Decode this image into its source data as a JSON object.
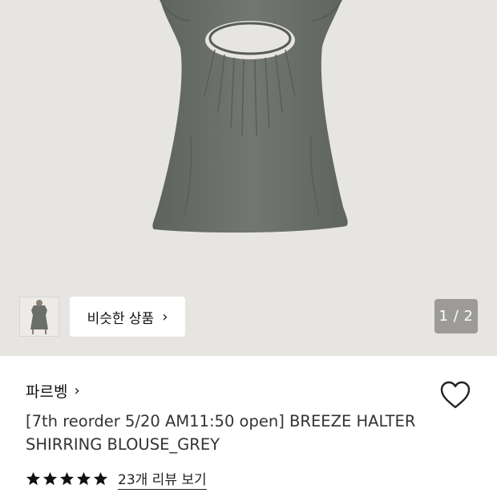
{
  "gallery": {
    "similar_label": "비슷한 상품",
    "similar_chevron": "›",
    "counter": "1 / 2"
  },
  "product": {
    "brand": "파르벵",
    "brand_chevron": "›",
    "title": "[7th reorder 5/20 AM11:50 open] BREEZE HALTER SHIRRING BLOUSE_GREY",
    "rating": 5,
    "review_link": "23개 리뷰 보기"
  },
  "colors": {
    "hero_bg": "#e7e5e2",
    "garment": "#6c716c",
    "star": "#111111",
    "heart_stroke": "#222222"
  },
  "icons": {
    "heart": "heart-outline-icon",
    "star": "star-icon",
    "chevron": "chevron-right-icon"
  }
}
